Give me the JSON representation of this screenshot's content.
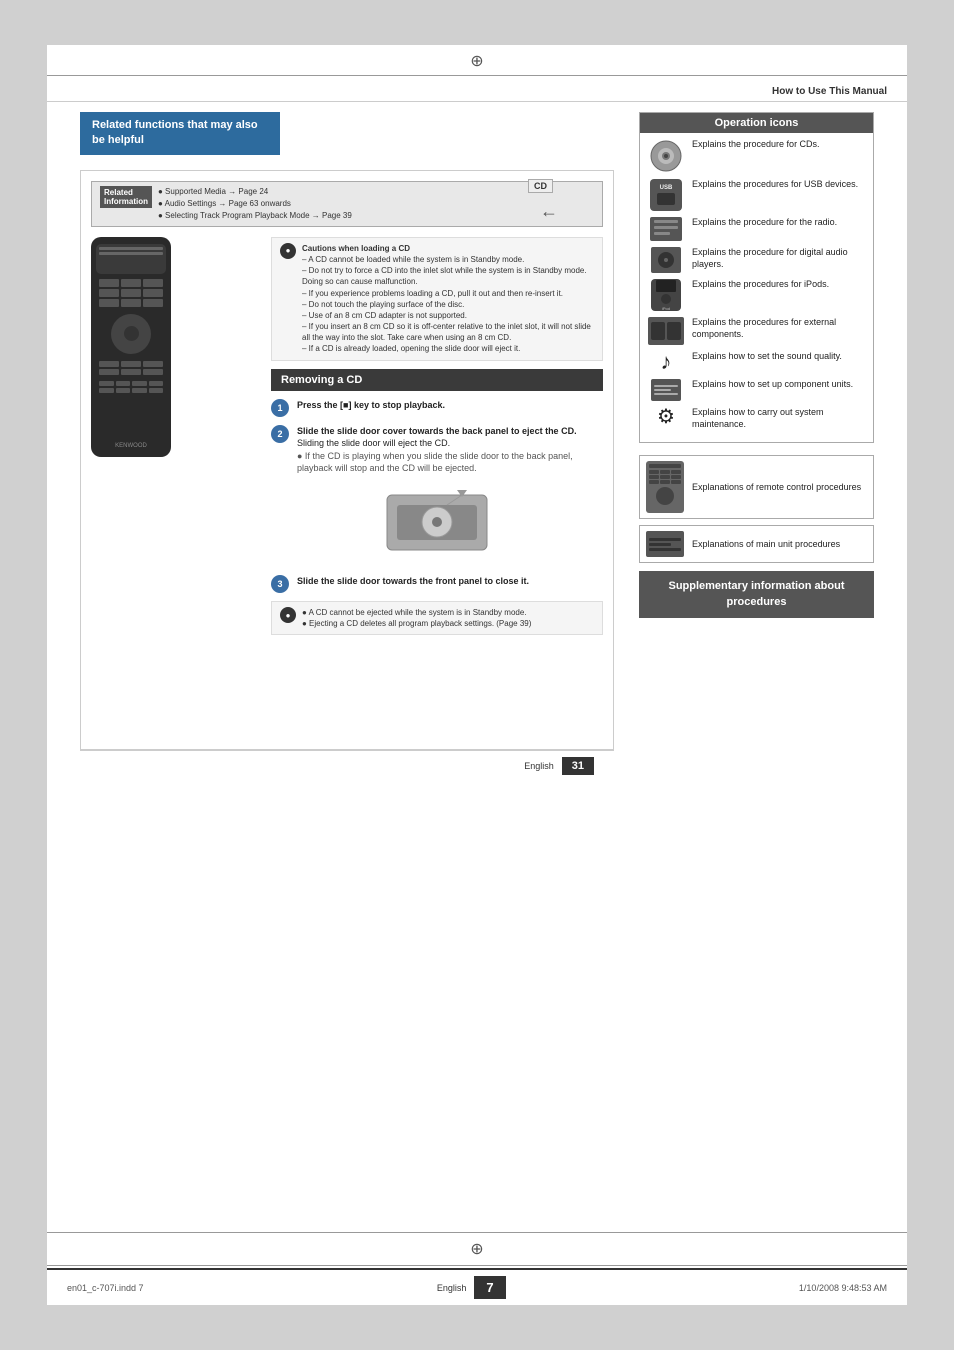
{
  "page": {
    "header": {
      "title": "How to Use This Manual"
    },
    "top_cross": "⊕",
    "bottom_cross": "⊕"
  },
  "right_panel": {
    "op_icons_title": "Operation icons",
    "icons": [
      {
        "id": "cd",
        "desc": "Explains the procedure for CDs."
      },
      {
        "id": "usb",
        "label": "USB",
        "desc": "Explains the procedures for USB devices."
      },
      {
        "id": "radio",
        "desc": "Explains the procedure for the radio."
      },
      {
        "id": "digital",
        "desc": "Explains the procedure for digital audio players."
      },
      {
        "id": "ipod",
        "label": "iPod",
        "desc": "Explains the procedures for iPods."
      },
      {
        "id": "external",
        "desc": "Explains the procedures for external components."
      },
      {
        "id": "sound",
        "desc": "Explains how to set the sound quality."
      },
      {
        "id": "setup",
        "desc": "Explains how to set up component units."
      },
      {
        "id": "maintenance",
        "desc": "Explains how to carry out system maintenance."
      }
    ],
    "explain_boxes": [
      {
        "id": "remote",
        "text": "Explanations of remote control procedures"
      },
      {
        "id": "main",
        "text": "Explanations of main unit procedures"
      }
    ],
    "supplementary": {
      "text": "Supplementary information about procedures"
    }
  },
  "left_panel": {
    "related_functions": {
      "label": "Related functions that may also be helpful"
    },
    "content_label": "CD",
    "related_info": {
      "label": "Related\nInformation",
      "items": [
        "● Supported Media → Page 24",
        "● Audio Settings → Page 63 onwards",
        "● Selecting Track Program Playback Mode → Page 39"
      ]
    },
    "caution_title": "Cautions when loading a CD",
    "cautions": [
      "A CD cannot be loaded while the system is in Standby mode.",
      "Do not try to force a CD into the inlet slot while the system is in Standby mode. Doing so can cause malfunction.",
      "If you experience problems loading a CD, pull it out and then re-insert it.",
      "Do not touch the playing surface of the disc.",
      "Use of an 8 cm CD adapter is not supported.",
      "If you insert an 8 cm CD so it is off-center relative to the inlet slot, it will not slide all the way into the slot. Take care when using an 8 cm CD.",
      "If a CD is already loaded, opening the slide door will eject it."
    ],
    "section_title": "Removing a CD",
    "steps": [
      {
        "num": "1",
        "text": "Press the [■] key to stop playback."
      },
      {
        "num": "2",
        "text": "Slide the slide door cover towards the back panel to eject the CD.",
        "detail": "Sliding the slide door will eject the CD.",
        "note": "● If the CD is playing when you slide the slide door to the back panel, playback will stop and the CD will be ejected."
      },
      {
        "num": "3",
        "text": "Slide the slide door towards the front panel to close it."
      }
    ],
    "final_notes": [
      "● A CD cannot be ejected while the system is in Standby mode.",
      "● Ejecting a CD deletes all program playback settings. (Page 39)"
    ]
  },
  "footer": {
    "language": "English",
    "page_num": "31"
  },
  "bottom_bar": {
    "file": "en01_c-707i.indd   7",
    "language": "English",
    "page": "7",
    "date": "1/10/2008   9:48:53 AM"
  }
}
